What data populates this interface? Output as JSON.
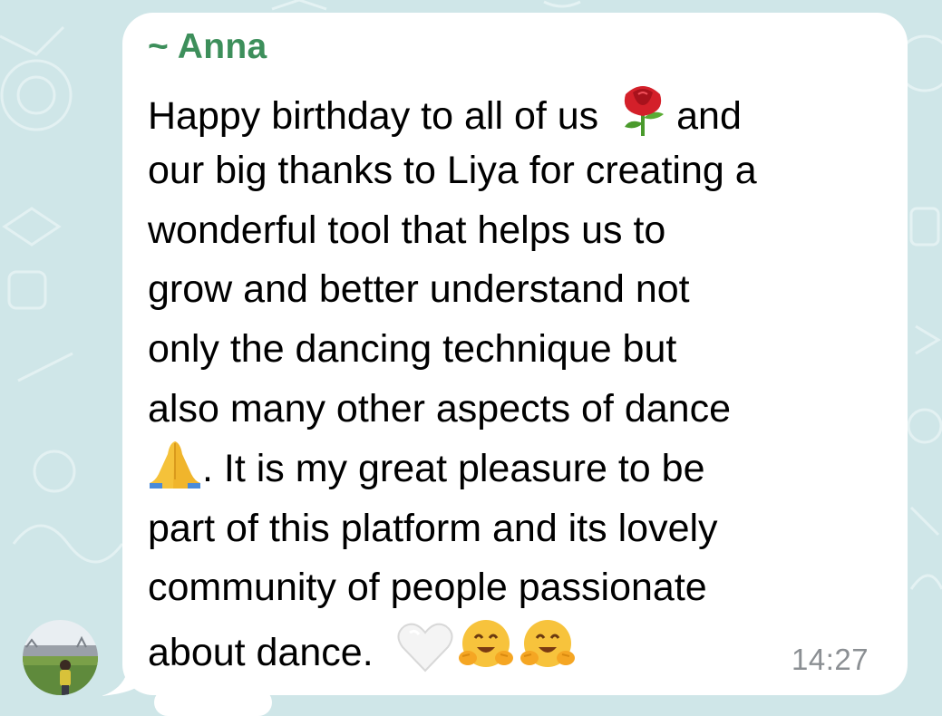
{
  "chat": {
    "sender_name": "~ Anna",
    "message_lines": [
      {
        "parts": [
          {
            "text": "Happy birthday to all of us "
          },
          {
            "emoji": "rose-emoji"
          },
          {
            "text": "and"
          }
        ]
      },
      {
        "parts": [
          {
            "text": "our big thanks to Liya for creating a"
          }
        ]
      },
      {
        "parts": [
          {
            "text": "wonderful tool that helps us to"
          }
        ]
      },
      {
        "parts": [
          {
            "text": "grow and better understand not"
          }
        ]
      },
      {
        "parts": [
          {
            "text": "only the dancing technique but"
          }
        ]
      },
      {
        "parts": [
          {
            "text": "also many other aspects of dance"
          }
        ]
      },
      {
        "parts": [
          {
            "emoji": "folded-hands-emoji"
          },
          {
            "text": ". It is my great pleasure to be"
          }
        ]
      },
      {
        "parts": [
          {
            "text": "part of this platform and its lovely"
          }
        ]
      },
      {
        "parts": [
          {
            "text": "community of people passionate"
          }
        ]
      },
      {
        "parts": [
          {
            "text": "about dance. "
          },
          {
            "emoji": "white-heart-emoji"
          },
          {
            "emoji": "hugging-face-emoji"
          },
          {
            "emoji": "hugging-face-emoji"
          }
        ]
      }
    ],
    "timestamp": "14:27"
  },
  "colors": {
    "background": "#cfe6e8",
    "bubble": "#ffffff",
    "sender_name": "#3d8f5b",
    "timestamp": "#8b8f93"
  },
  "icons": [
    "rose-emoji",
    "folded-hands-emoji",
    "white-heart-emoji",
    "hugging-face-emoji"
  ]
}
